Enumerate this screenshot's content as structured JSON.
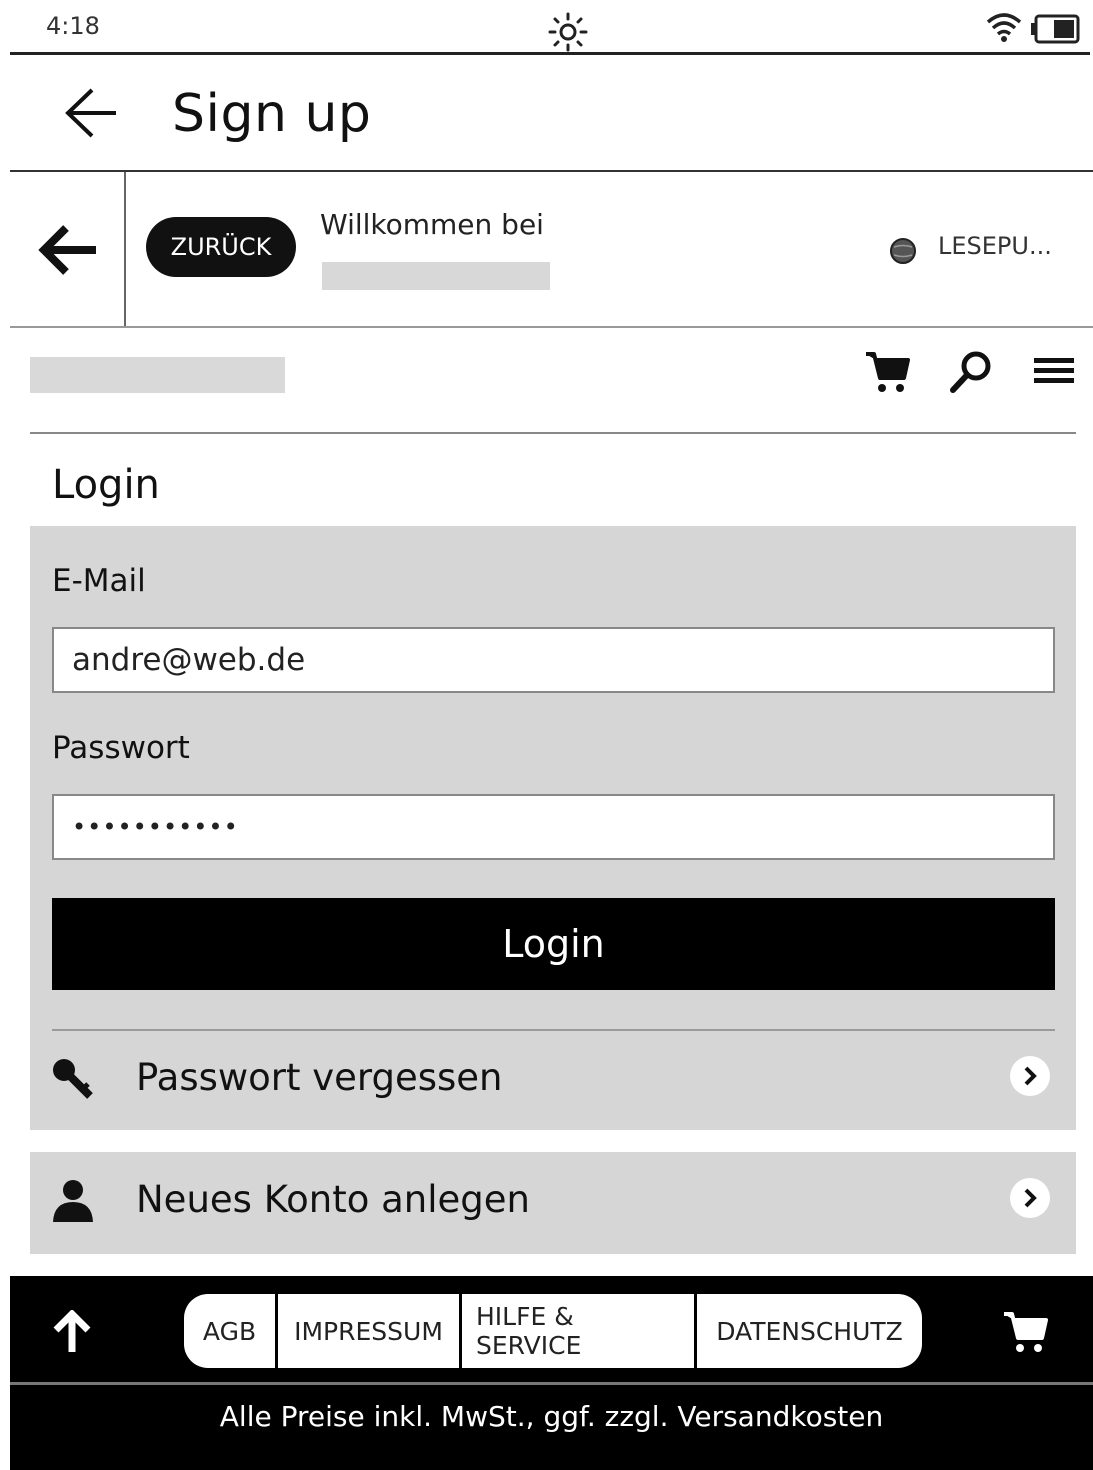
{
  "status_bar": {
    "time": "4:18"
  },
  "app_header": {
    "title": "Sign up"
  },
  "site_header": {
    "back_button_label": "ZURÜCK",
    "welcome_text": "Willkommen bei",
    "language_label": "LESEPU..."
  },
  "nav": {
    "icons": [
      "cart-icon",
      "search-icon",
      "menu-icon"
    ]
  },
  "login": {
    "heading": "Login",
    "email_label": "E-Mail",
    "email_value": "andre@web.de",
    "password_label": "Passwort",
    "password_value": "•••••••••••",
    "submit_label": "Login",
    "forgot_password": "Passwort vergessen",
    "new_account": "Neues Konto anlegen"
  },
  "footer": {
    "links": [
      "AGB",
      "IMPRESSUM",
      "HILFE & SERVICE",
      "DATENSCHUTZ"
    ],
    "note": "Alle Preise inkl. MwSt., ggf. zzgl. Versandkosten"
  }
}
